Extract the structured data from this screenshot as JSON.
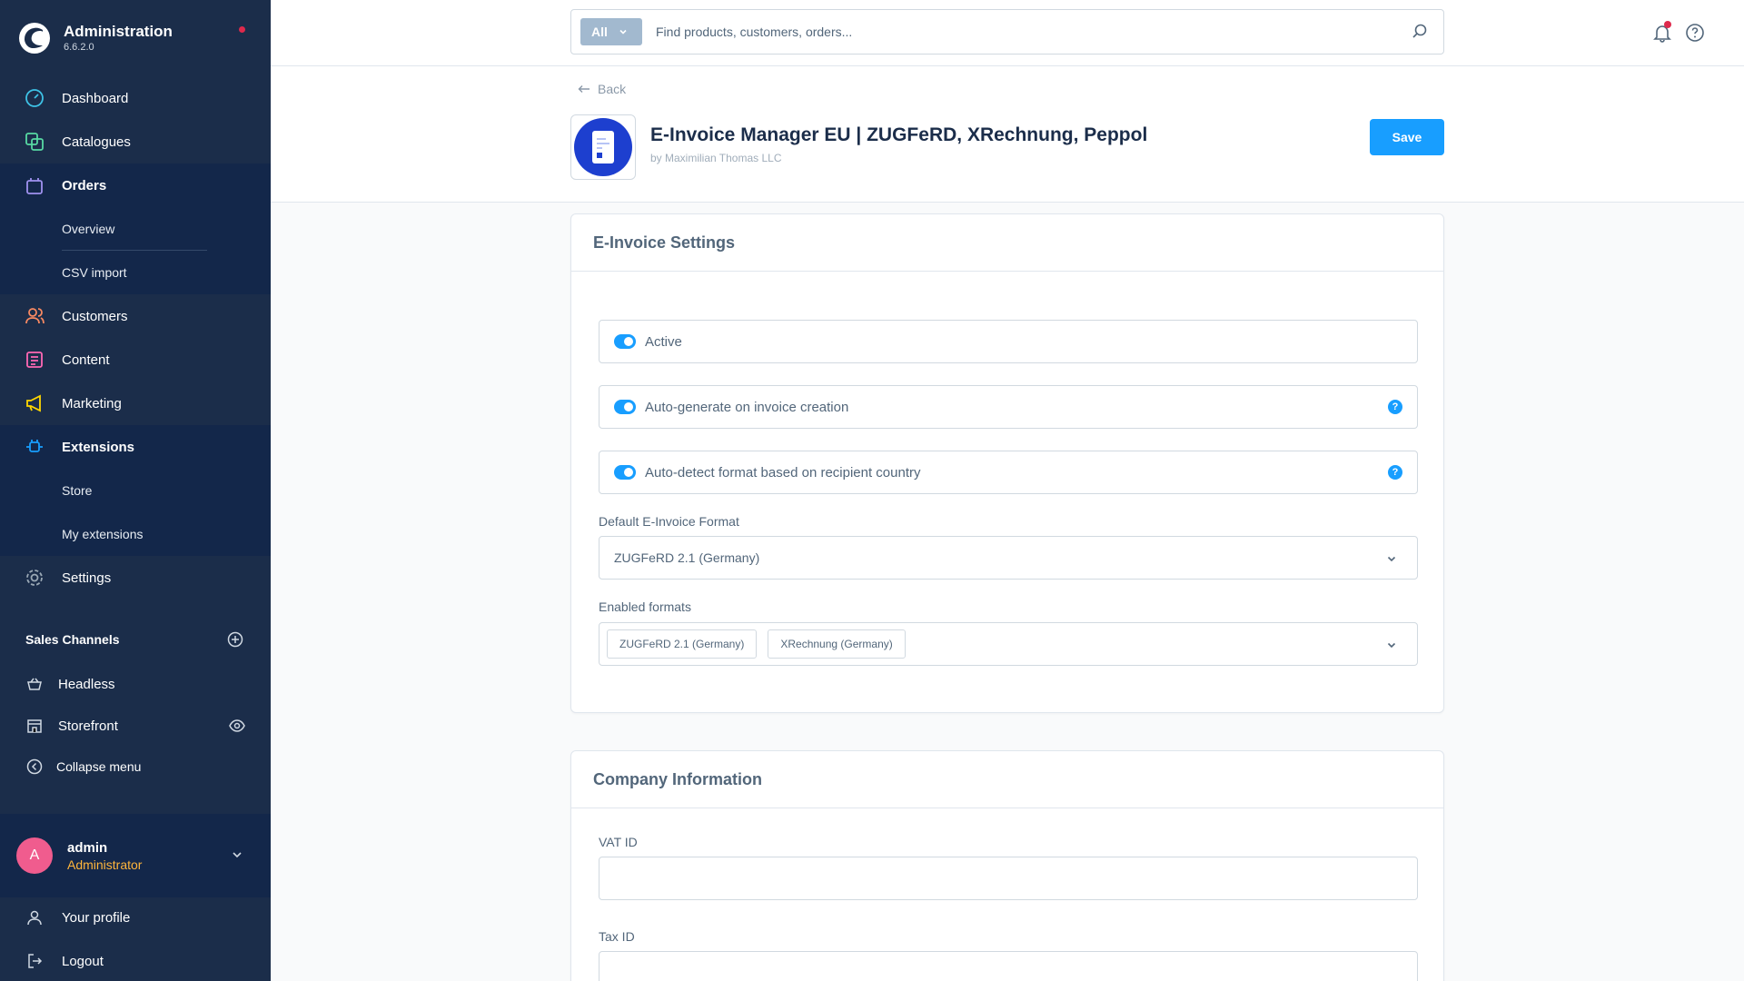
{
  "brand": {
    "title": "Administration",
    "version": "6.6.2.0"
  },
  "nav": {
    "dashboard": "Dashboard",
    "catalogues": "Catalogues",
    "orders": "Orders",
    "orders_overview": "Overview",
    "orders_csv_import": "CSV import",
    "customers": "Customers",
    "content": "Content",
    "marketing": "Marketing",
    "extensions": "Extensions",
    "extensions_store": "Store",
    "extensions_my": "My extensions",
    "settings": "Settings"
  },
  "sales_channels": {
    "title": "Sales Channels",
    "items": [
      "Headless",
      "Storefront"
    ],
    "collapse": "Collapse menu"
  },
  "user": {
    "initial": "A",
    "name": "admin",
    "role": "Administrator"
  },
  "bottom": {
    "profile": "Your profile",
    "logout": "Logout"
  },
  "search": {
    "type": "All",
    "placeholder": "Find products, customers, orders..."
  },
  "header": {
    "back": "Back",
    "title": "E-Invoice Manager EU | ZUGFeRD, XRechnung, Peppol",
    "author": "by Maximilian Thomas LLC",
    "save": "Save"
  },
  "einvoice": {
    "title": "E-Invoice Settings",
    "active_label": "Active",
    "autogen_label": "Auto-generate on invoice creation",
    "autodetect_label": "Auto-detect format based on recipient country",
    "default_format_label": "Default E-Invoice Format",
    "default_format_value": "ZUGFeRD 2.1 (Germany)",
    "enabled_formats_label": "Enabled formats",
    "enabled_formats": [
      "ZUGFeRD 2.1 (Germany)",
      "XRechnung (Germany)"
    ]
  },
  "company": {
    "title": "Company Information",
    "vat_label": "VAT ID",
    "vat_value": "",
    "tax_label": "Tax ID",
    "tax_value": ""
  },
  "colors": {
    "sidebar": "#1b2d4a",
    "sidebar_active": "#13274a",
    "primary": "#189eff",
    "role": "#ffb53b",
    "avatar": "#f05c8e"
  }
}
